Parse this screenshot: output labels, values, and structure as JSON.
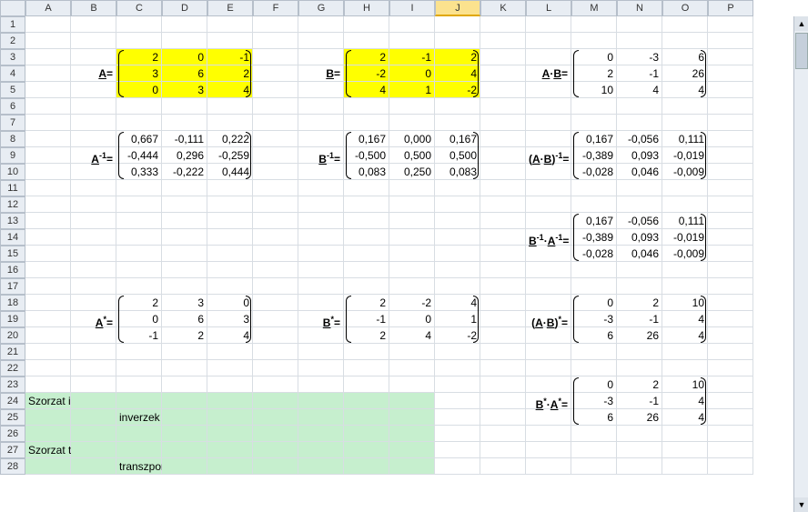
{
  "columns": [
    "A",
    "B",
    "C",
    "D",
    "E",
    "F",
    "G",
    "H",
    "I",
    "J",
    "K",
    "L",
    "M",
    "N",
    "O",
    "P"
  ],
  "row_count": 28,
  "selected_column": "J",
  "labels": {
    "A_eq": "A=",
    "B_eq": "B=",
    "AB_eq": "A·B=",
    "Ainv_eq": "A⁻¹=",
    "Binv_eq": "B⁻¹=",
    "ABinv_eq": "(A·B)⁻¹=",
    "BinvAinv_eq": "B⁻¹·A⁻¹=",
    "At_eq": "A*=",
    "Bt_eq": "B*=",
    "ABt_eq": "(A·B)*=",
    "BtAt_eq": "B*·A*="
  },
  "matrices": {
    "A": [
      [
        2,
        0,
        -1
      ],
      [
        3,
        6,
        2
      ],
      [
        0,
        3,
        4
      ]
    ],
    "B": [
      [
        2,
        -1,
        2
      ],
      [
        -2,
        0,
        4
      ],
      [
        4,
        1,
        -2
      ]
    ],
    "AB": [
      [
        0,
        -3,
        6
      ],
      [
        2,
        -1,
        26
      ],
      [
        10,
        4,
        4
      ]
    ],
    "Ainv": [
      [
        "0,667",
        "-0,111",
        "0,222"
      ],
      [
        "-0,444",
        "0,296",
        "-0,259"
      ],
      [
        "0,333",
        "-0,222",
        "0,444"
      ]
    ],
    "Binv": [
      [
        "0,167",
        "0,000",
        "0,167"
      ],
      [
        "-0,500",
        "0,500",
        "0,500"
      ],
      [
        "0,083",
        "0,250",
        "0,083"
      ]
    ],
    "ABinv": [
      [
        "0,167",
        "-0,056",
        "0,111"
      ],
      [
        "-0,389",
        "0,093",
        "-0,019"
      ],
      [
        "-0,028",
        "0,046",
        "-0,009"
      ]
    ],
    "BinvAinv": [
      [
        "0,167",
        "-0,056",
        "0,111"
      ],
      [
        "-0,389",
        "0,093",
        "-0,019"
      ],
      [
        "-0,028",
        "0,046",
        "-0,009"
      ]
    ],
    "At": [
      [
        2,
        3,
        0
      ],
      [
        0,
        6,
        3
      ],
      [
        -1,
        2,
        4
      ]
    ],
    "Bt": [
      [
        2,
        -2,
        4
      ],
      [
        -1,
        0,
        1
      ],
      [
        2,
        4,
        -2
      ]
    ],
    "ABt": [
      [
        0,
        2,
        10
      ],
      [
        -3,
        -1,
        4
      ],
      [
        6,
        26,
        4
      ]
    ],
    "BtAt": [
      [
        0,
        2,
        10
      ],
      [
        -3,
        -1,
        4
      ],
      [
        6,
        26,
        4
      ]
    ]
  },
  "notes": {
    "line1": "Szorzat inverze =",
    "line2": "inverzek fordított sorrendű szorzata",
    "line3": "Szorzat transzponáltja =",
    "line4": "transzponáltak fordított sorrendű szorzata"
  }
}
